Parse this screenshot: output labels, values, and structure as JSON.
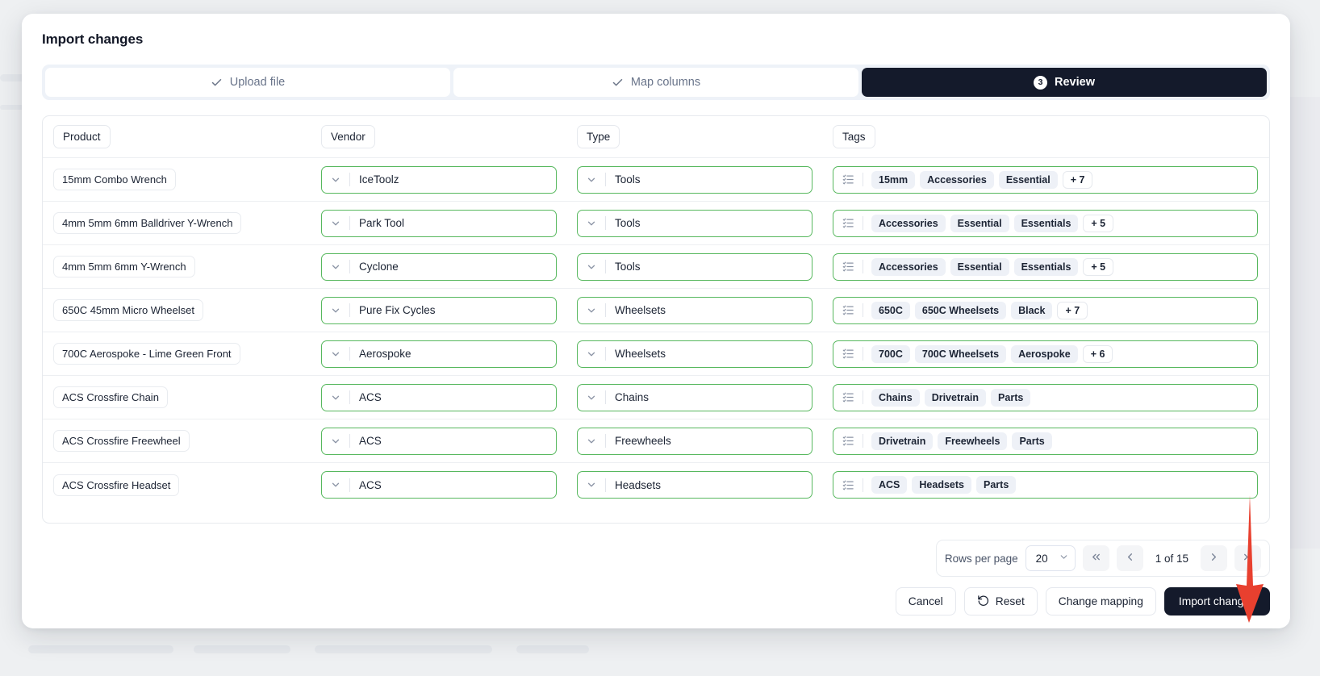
{
  "modal": {
    "title": "Import changes"
  },
  "stepper": {
    "steps": [
      {
        "label": "Upload file",
        "state": "done",
        "icon": "check-icon"
      },
      {
        "label": "Map columns",
        "state": "done",
        "icon": "check-icon"
      },
      {
        "label": "Review",
        "state": "active",
        "number": "3"
      }
    ]
  },
  "table": {
    "headers": [
      "Product",
      "Vendor",
      "Type",
      "Tags"
    ],
    "rows": [
      {
        "product": "15mm Combo Wrench",
        "vendor": "IceToolz",
        "type": "Tools",
        "tags": [
          "15mm",
          "Accessories",
          "Essential"
        ],
        "more": "+ 7"
      },
      {
        "product": "4mm 5mm 6mm Balldriver Y-Wrench",
        "vendor": "Park Tool",
        "type": "Tools",
        "tags": [
          "Accessories",
          "Essential",
          "Essentials"
        ],
        "more": "+ 5"
      },
      {
        "product": "4mm 5mm 6mm Y-Wrench",
        "vendor": "Cyclone",
        "type": "Tools",
        "tags": [
          "Accessories",
          "Essential",
          "Essentials"
        ],
        "more": "+ 5"
      },
      {
        "product": "650C 45mm Micro Wheelset",
        "vendor": "Pure Fix Cycles",
        "type": "Wheelsets",
        "tags": [
          "650C",
          "650C Wheelsets",
          "Black"
        ],
        "more": "+ 7"
      },
      {
        "product": "700C Aerospoke - Lime Green Front",
        "vendor": "Aerospoke",
        "type": "Wheelsets",
        "tags": [
          "700C",
          "700C Wheelsets",
          "Aerospoke"
        ],
        "more": "+ 6"
      },
      {
        "product": "ACS Crossfire Chain",
        "vendor": "ACS",
        "type": "Chains",
        "tags": [
          "Chains",
          "Drivetrain",
          "Parts"
        ],
        "more": ""
      },
      {
        "product": "ACS Crossfire Freewheel",
        "vendor": "ACS",
        "type": "Freewheels",
        "tags": [
          "Drivetrain",
          "Freewheels",
          "Parts"
        ],
        "more": ""
      },
      {
        "product": "ACS Crossfire Headset",
        "vendor": "ACS",
        "type": "Headsets",
        "tags": [
          "ACS",
          "Headsets",
          "Parts"
        ],
        "more": ""
      }
    ]
  },
  "pagination": {
    "rows_per_page_label": "Rows per page",
    "rows_per_page_value": "20",
    "page_indicator": "1 of 15",
    "first_icon": "double-chevron-left-icon",
    "prev_icon": "chevron-left-icon",
    "next_icon": "chevron-right-icon",
    "last_icon": "double-chevron-right-icon"
  },
  "footer": {
    "cancel": "Cancel",
    "reset": "Reset",
    "reset_icon": "undo-icon",
    "change_mapping": "Change mapping",
    "import_changes": "Import changes"
  },
  "colors": {
    "accent_green": "#57b85e",
    "dark": "#141a2b",
    "annotation_red": "#e8402f",
    "tag_bg": "#eef1f7"
  }
}
